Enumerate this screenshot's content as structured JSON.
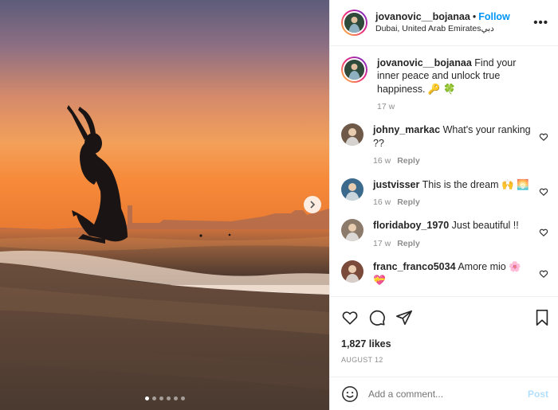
{
  "post": {
    "username": "jovanovic__bojanaa",
    "separator": "•",
    "follow_label": "Follow",
    "location": "Dubai, United Arab Emiratesدبي",
    "more_label": "•••",
    "caption_text": "Find your inner peace and unlock true happiness. 🔑 🍀",
    "caption_age": "17 w"
  },
  "comments": [
    {
      "username": "johny_markac",
      "text": "What's your ranking ??",
      "age": "16 w",
      "reply_label": "Reply",
      "avatar_color": "#6f5a4a"
    },
    {
      "username": "justvisser",
      "text": "This is the dream 🙌 🌅",
      "age": "16 w",
      "reply_label": "Reply",
      "avatar_color": "#3b6a8c"
    },
    {
      "username": "floridaboy_1970",
      "text": "Just beautiful !!",
      "age": "17 w",
      "reply_label": "Reply",
      "avatar_color": "#8c7a6a"
    },
    {
      "username": "franc_franco5034",
      "text": "Amore mio 🌸 💝",
      "age": "",
      "reply_label": "",
      "avatar_color": "#7a4a3a"
    }
  ],
  "stats": {
    "likes": "1,827 likes",
    "date": "AUGUST 12"
  },
  "add_comment": {
    "placeholder": "Add a comment...",
    "post_label": "Post"
  },
  "carousel": {
    "total": 6,
    "current": 1
  },
  "colors": {
    "accent": "#0095f6",
    "post_disabled": "#b2dffc"
  }
}
